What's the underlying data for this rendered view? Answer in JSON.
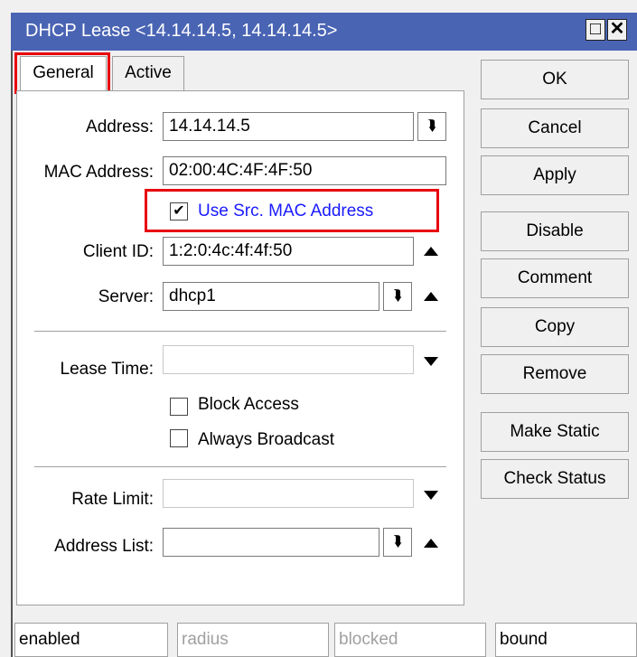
{
  "window": {
    "title": "DHCP Lease <14.14.14.5, 14.14.14.5>",
    "maximize_glyph": "□",
    "close_glyph": "✕"
  },
  "tabs": [
    {
      "label": "General",
      "active": true
    },
    {
      "label": "Active",
      "active": false
    }
  ],
  "form": {
    "address": {
      "label": "Address:",
      "value": "14.14.14.5"
    },
    "mac_address": {
      "label": "MAC Address:",
      "value": "02:00:4C:4F:4F:50"
    },
    "use_src_mac": {
      "label": "Use Src. MAC Address",
      "checked": true
    },
    "client_id": {
      "label": "Client ID:",
      "value": "1:2:0:4c:4f:4f:50"
    },
    "server": {
      "label": "Server:",
      "value": "dhcp1"
    },
    "lease_time": {
      "label": "Lease Time:",
      "value": ""
    },
    "block_access": {
      "label": "Block Access",
      "checked": false
    },
    "always_broadcast": {
      "label": "Always Broadcast",
      "checked": false
    },
    "rate_limit": {
      "label": "Rate Limit:",
      "value": ""
    },
    "address_list": {
      "label": "Address List:",
      "value": ""
    }
  },
  "buttons": {
    "ok": "OK",
    "cancel": "Cancel",
    "apply": "Apply",
    "disable": "Disable",
    "comment": "Comment",
    "copy": "Copy",
    "remove": "Remove",
    "make_static": "Make Static",
    "check_status": "Check Status"
  },
  "status_bar": [
    "enabled",
    "radius",
    "blocked",
    "bound"
  ],
  "icons": {
    "dropdown": "dropdown-icon",
    "expand_up": "triangle-up-icon",
    "expand_down": "triangle-down-icon",
    "check": "checkmark-icon"
  },
  "colors": {
    "titlebar": "#4a64b4",
    "highlight": "#e8000c",
    "link_text": "#1a1aff"
  }
}
